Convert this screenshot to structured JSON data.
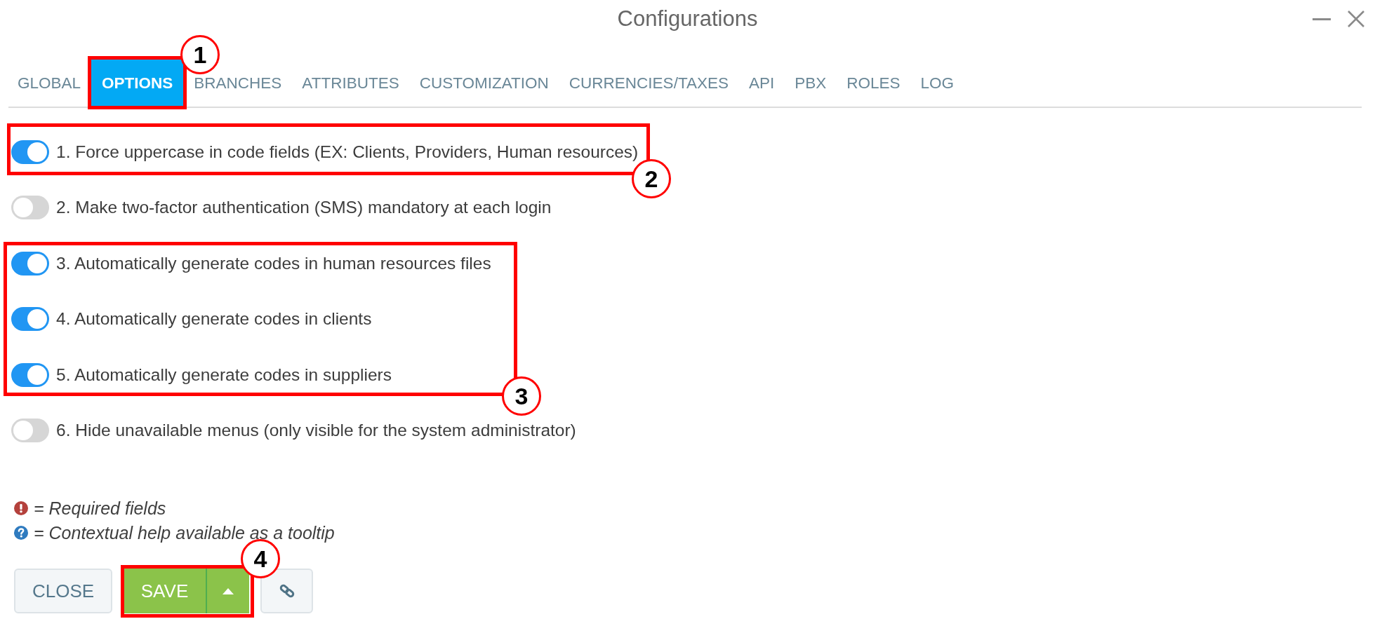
{
  "window": {
    "title": "Configurations"
  },
  "tabs": [
    {
      "label": "GLOBAL",
      "selected": false
    },
    {
      "label": "OPTIONS",
      "selected": true
    },
    {
      "label": "BRANCHES",
      "selected": false
    },
    {
      "label": "ATTRIBUTES",
      "selected": false
    },
    {
      "label": "CUSTOMIZATION",
      "selected": false
    },
    {
      "label": "CURRENCIES/TAXES",
      "selected": false
    },
    {
      "label": "API",
      "selected": false
    },
    {
      "label": "PBX",
      "selected": false
    },
    {
      "label": "ROLES",
      "selected": false
    },
    {
      "label": "LOG",
      "selected": false
    }
  ],
  "options": [
    {
      "label": "1. Force uppercase in code fields (EX: Clients, Providers, Human resources)",
      "on": true
    },
    {
      "label": "2. Make two-factor authentication (SMS) mandatory at each login",
      "on": false
    },
    {
      "label": "3. Automatically generate codes in human resources files",
      "on": true
    },
    {
      "label": "4. Automatically generate codes in clients",
      "on": true
    },
    {
      "label": "5. Automatically generate codes in suppliers",
      "on": true
    },
    {
      "label": "6. Hide unavailable menus (only visible for the system administrator)",
      "on": false
    }
  ],
  "legend": [
    {
      "kind": "required",
      "text": "= Required fields"
    },
    {
      "kind": "help",
      "text": "= Contextual help available as a tooltip"
    }
  ],
  "buttons": [
    {
      "kind": "close",
      "label": "CLOSE"
    },
    {
      "kind": "save",
      "label": "SAVE"
    },
    {
      "kind": "link"
    }
  ],
  "callouts": [
    {
      "number": "1"
    },
    {
      "number": "2"
    },
    {
      "number": "3"
    },
    {
      "number": "4"
    }
  ]
}
